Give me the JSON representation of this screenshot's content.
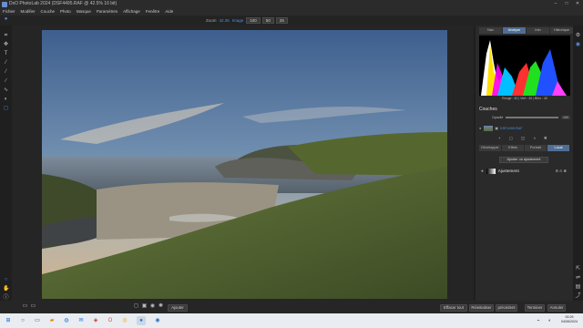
{
  "window": {
    "title": "DxO PhotoLab 2024 (DSF4495.RAF @ 42.5% 16 bit)",
    "controls": [
      "–",
      "□",
      "✕"
    ]
  },
  "menu": [
    "Fichier",
    "Modifier",
    "Couche",
    "Photo",
    "Masque",
    "Paramètres",
    "Affichage",
    "Fenêtre",
    "Aide"
  ],
  "zoom": {
    "label": "Zoom",
    "value": "42.35",
    "fit": "Image",
    "buttons": [
      "100",
      "50",
      "25"
    ]
  },
  "panel": {
    "tabs": [
      "Nav",
      "Analyse",
      "Info",
      "Historique"
    ],
    "active_tab": 1,
    "histogram_readout": "Rouge : 40 | Vert : 40 | Bleu : 40",
    "layers_title": "Couches",
    "opacity_label": "Opacité",
    "opacity_value": "100",
    "layer_name": "DSF4495.RAF",
    "subtabs": [
      "Développer",
      "Effets",
      "Portrait",
      "Local"
    ],
    "active_subtab": 3,
    "add_adjustment": "Ajouter un ajustement",
    "adjustment_name": "Ajustement"
  },
  "bottom": {
    "left_button": "Ajouter",
    "buttons": [
      "Effacer tout",
      "Réinitialiser",
      "précédent",
      "Terminer",
      "Annuler"
    ]
  },
  "clock": {
    "time": "00:25",
    "date": "04/06/2024"
  },
  "colors": {
    "accent": "#4e8fe0",
    "active_tab": "#4f6e95"
  }
}
